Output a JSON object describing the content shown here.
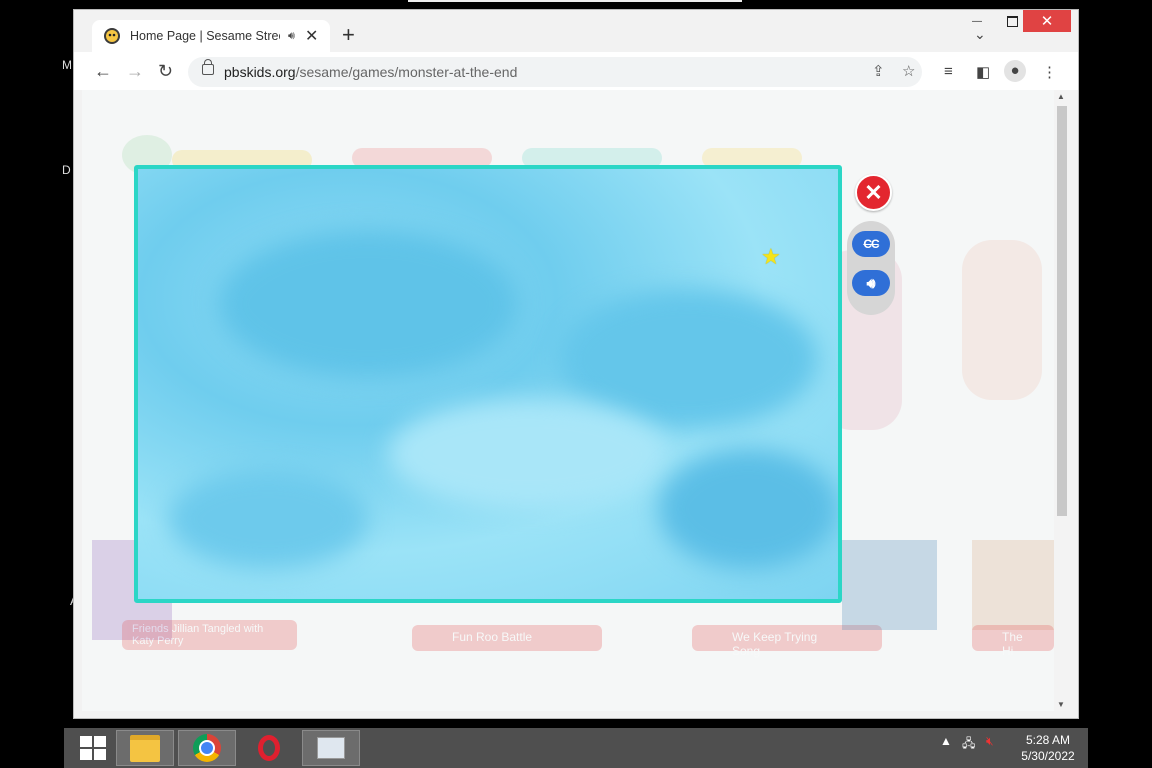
{
  "desktop": {
    "fragments": [
      "M",
      "D",
      "A"
    ]
  },
  "browser": {
    "tab": {
      "title": "Home Page | Sesame Street |",
      "audio_icon": "speaker-icon",
      "close": "✕"
    },
    "new_tab": "+",
    "window_controls": {
      "minimize": "—",
      "close": "✕"
    },
    "address": {
      "domain": "pbskids.org",
      "path": "/sesame/games/monster-at-the-end"
    }
  },
  "game": {
    "close_label": "✕",
    "cc_label": "CC",
    "volume_icon": "speaker-icon",
    "colors": {
      "frame": "#2bd6c6",
      "sky": "#7dd4f1",
      "close": "#e3262f",
      "control": "#2f6fd7",
      "star": "#f4e41b"
    }
  },
  "background_page": {
    "cards": [
      "Friends Jillian Tangled with Katy Perry",
      "Fun Roo Battle",
      "We Keep Trying Song",
      "The Hi"
    ]
  },
  "taskbar": {
    "clock": {
      "time": "5:28 AM",
      "date": "5/30/2022"
    }
  }
}
